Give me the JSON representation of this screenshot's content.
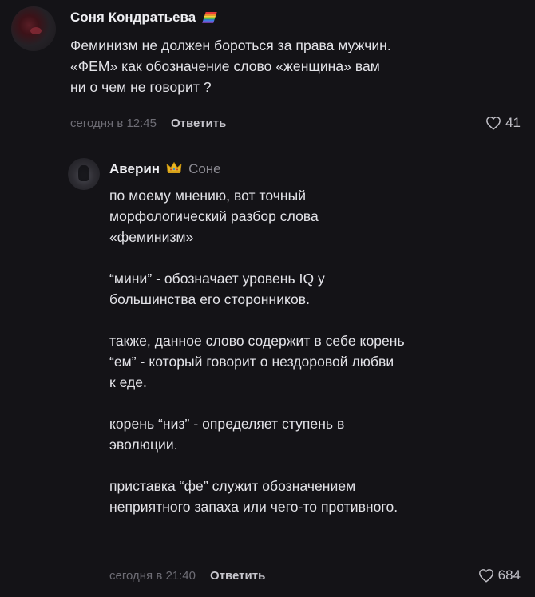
{
  "comments": [
    {
      "author": "Соня Кондратьева",
      "badge_icon": "rainbow-flag-icon",
      "text": "Феминизм не должен бороться за права мужчин.\n«ФЕМ» как обозначение слово «женщина» вам\nни о чем не говорит ?",
      "time": "сегодня в 12:45",
      "reply_label": "Ответить",
      "likes": "41"
    },
    {
      "author": "Аверин",
      "badge_icon": "crown-icon",
      "reply_to": "Соне",
      "text": "по моему мнению, вот точный\nморфологический разбор слова\n«феминизм»\n\n“мини” - обозначает уровень IQ у\nбольшинства его сторонников.\n\nтакже, данное слово содержит в себе корень\n“ем” - который говорит о нездоровой любви\nк еде.\n\nкорень “низ” - определяет ступень в\nэволюции.\n\nприставка “фе” служит обозначением\nнеприятного запаха или чего-то противного.",
      "time": "сегодня в 21:40",
      "reply_label": "Ответить",
      "likes": "684"
    }
  ],
  "colors": {
    "background": "#141317",
    "text": "#e3e3e8",
    "muted": "#6e6d75",
    "reply_button": "#c7c6cd"
  }
}
